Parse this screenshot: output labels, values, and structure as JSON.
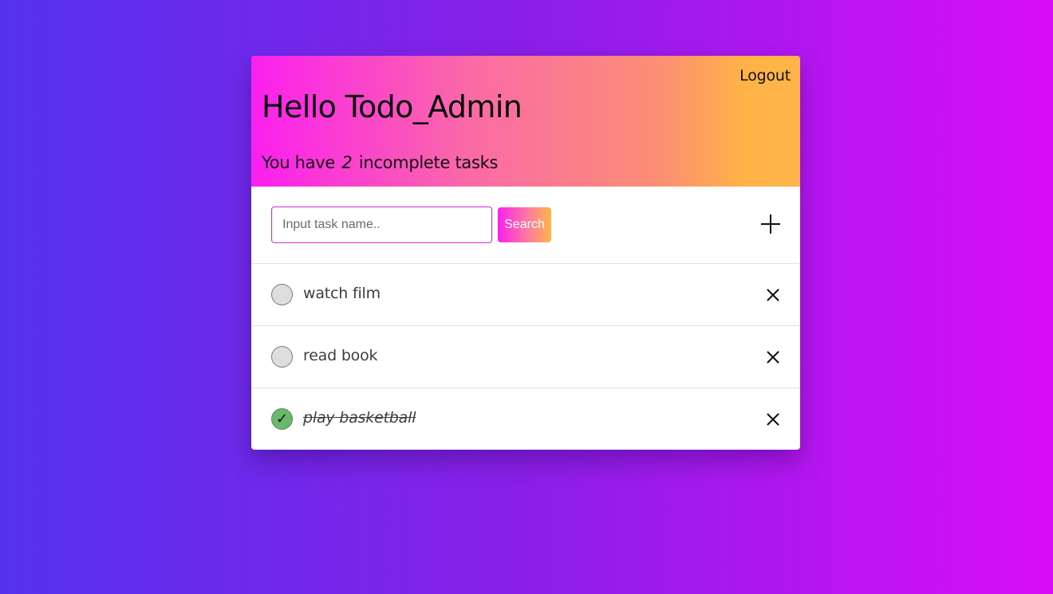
{
  "header": {
    "logout_label": "Logout",
    "greeting": "Hello Todo_Admin",
    "summary_prefix": "You have",
    "incomplete_count": "2",
    "summary_suffix": "incomplete tasks"
  },
  "toolbar": {
    "search_placeholder": "Input task name..",
    "search_value": "",
    "search_button_label": "Search",
    "add_icon": "plus-icon"
  },
  "tasks": [
    {
      "name": "watch film",
      "completed": false
    },
    {
      "name": "read book",
      "completed": false
    },
    {
      "name": "play basketball",
      "completed": true,
      "check_glyph": "✓"
    }
  ],
  "colors": {
    "page_gradient": [
      "#5432ed",
      "#d80ef6"
    ],
    "header_gradient": [
      "#fb1ff0",
      "#ffb44a"
    ],
    "completed_check": "#6ab86a"
  }
}
